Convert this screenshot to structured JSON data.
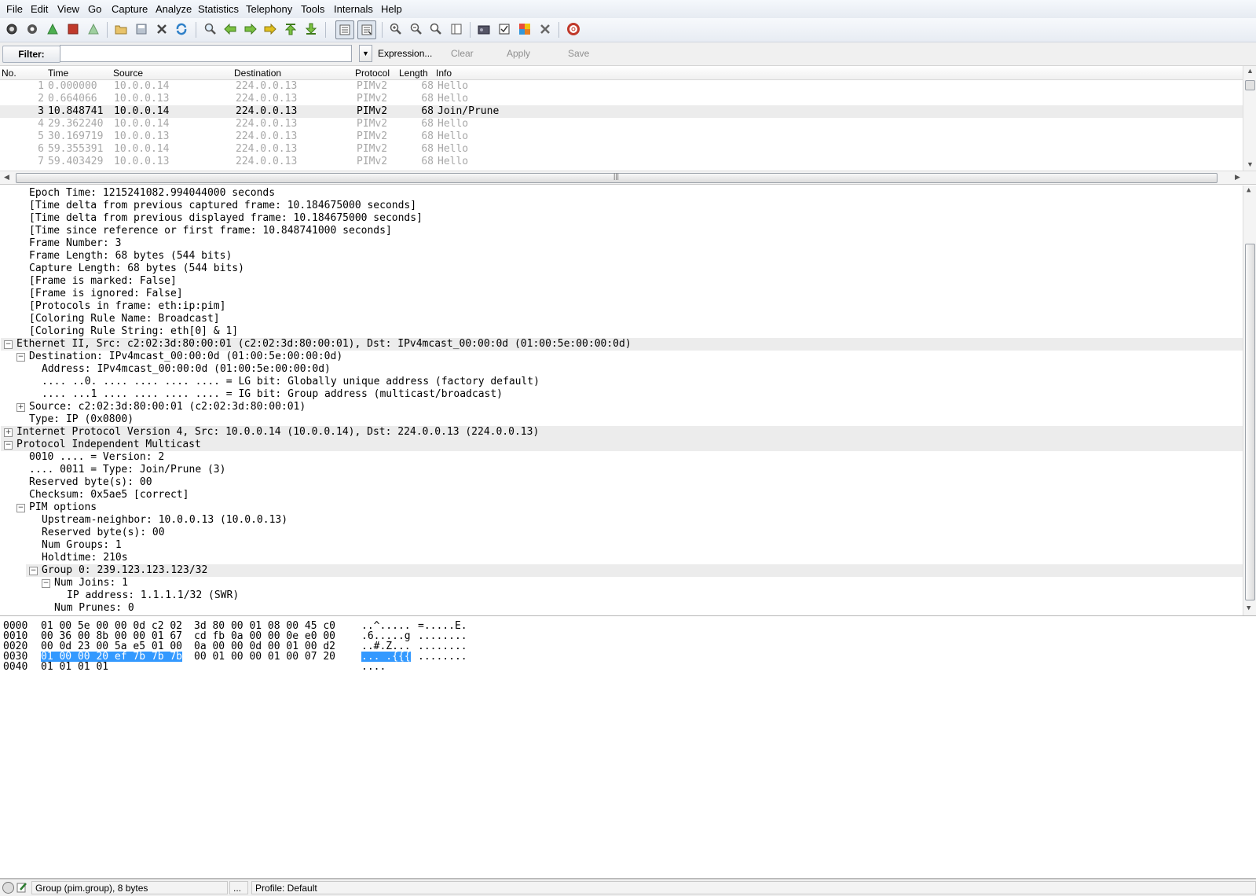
{
  "menu": [
    "File",
    "Edit",
    "View",
    "Go",
    "Capture",
    "Analyze",
    "Statistics",
    "Telephony",
    "Tools",
    "Internals",
    "Help"
  ],
  "filter": {
    "label": "Filter:",
    "value": "",
    "expression": "Expression...",
    "clear": "Clear",
    "apply": "Apply",
    "save": "Save"
  },
  "columns": {
    "no": "No.",
    "time": "Time",
    "source": "Source",
    "destination": "Destination",
    "protocol": "Protocol",
    "length": "Length",
    "info": "Info"
  },
  "packets": [
    {
      "no": "1",
      "time": "0.000000",
      "src": "10.0.0.14",
      "dst": "224.0.0.13",
      "proto": "PIMv2",
      "len": "68",
      "info": "Hello"
    },
    {
      "no": "2",
      "time": "0.664066",
      "src": "10.0.0.13",
      "dst": "224.0.0.13",
      "proto": "PIMv2",
      "len": "68",
      "info": "Hello"
    },
    {
      "no": "3",
      "time": "10.848741",
      "src": "10.0.0.14",
      "dst": "224.0.0.13",
      "proto": "PIMv2",
      "len": "68",
      "info": "Join/Prune"
    },
    {
      "no": "4",
      "time": "29.362240",
      "src": "10.0.0.14",
      "dst": "224.0.0.13",
      "proto": "PIMv2",
      "len": "68",
      "info": "Hello"
    },
    {
      "no": "5",
      "time": "30.169719",
      "src": "10.0.0.13",
      "dst": "224.0.0.13",
      "proto": "PIMv2",
      "len": "68",
      "info": "Hello"
    },
    {
      "no": "6",
      "time": "59.355391",
      "src": "10.0.0.14",
      "dst": "224.0.0.13",
      "proto": "PIMv2",
      "len": "68",
      "info": "Hello"
    },
    {
      "no": "7",
      "time": "59.403429",
      "src": "10.0.0.13",
      "dst": "224.0.0.13",
      "proto": "PIMv2",
      "len": "68",
      "info": "Hello"
    }
  ],
  "details": [
    {
      "t": "Epoch Time: 1215241082.994044000 seconds"
    },
    {
      "t": "[Time delta from previous captured frame: 10.184675000 seconds]"
    },
    {
      "t": "[Time delta from previous displayed frame: 10.184675000 seconds]"
    },
    {
      "t": "[Time since reference or first frame: 10.848741000 seconds]"
    },
    {
      "t": "Frame Number: 3"
    },
    {
      "t": "Frame Length: 68 bytes (544 bits)"
    },
    {
      "t": "Capture Length: 68 bytes (544 bits)"
    },
    {
      "t": "[Frame is marked: False]"
    },
    {
      "t": "[Frame is ignored: False]"
    },
    {
      "t": "[Protocols in frame: eth:ip:pim]"
    },
    {
      "t": "[Coloring Rule Name: Broadcast]"
    },
    {
      "t": "[Coloring Rule String: eth[0] & 1]"
    },
    {
      "t": "Ethernet II, Src: c2:02:3d:80:00:01 (c2:02:3d:80:00:01), Dst: IPv4mcast_00:00:0d (01:00:5e:00:00:0d)"
    },
    {
      "t": "Destination: IPv4mcast_00:00:0d (01:00:5e:00:00:0d)"
    },
    {
      "t": "Address: IPv4mcast_00:00:0d (01:00:5e:00:00:0d)"
    },
    {
      "t": ".... ..0. .... .... .... .... = LG bit: Globally unique address (factory default)"
    },
    {
      "t": ".... ...1 .... .... .... .... = IG bit: Group address (multicast/broadcast)"
    },
    {
      "t": "Source: c2:02:3d:80:00:01 (c2:02:3d:80:00:01)"
    },
    {
      "t": "Type: IP (0x0800)"
    },
    {
      "t": "Internet Protocol Version 4, Src: 10.0.0.14 (10.0.0.14), Dst: 224.0.0.13 (224.0.0.13)"
    },
    {
      "t": "Protocol Independent Multicast"
    },
    {
      "t": "0010 .... = Version: 2"
    },
    {
      "t": ".... 0011 = Type: Join/Prune (3)"
    },
    {
      "t": "Reserved byte(s): 00"
    },
    {
      "t": "Checksum: 0x5ae5 [correct]"
    },
    {
      "t": "PIM options"
    },
    {
      "t": "Upstream-neighbor: 10.0.0.13 (10.0.0.13)"
    },
    {
      "t": "Reserved byte(s): 00"
    },
    {
      "t": "Num Groups: 1"
    },
    {
      "t": "Holdtime: 210s"
    },
    {
      "t": "Group 0: 239.123.123.123/32"
    },
    {
      "t": "Num Joins: 1"
    },
    {
      "t": "IP address: 1.1.1.1/32 (SWR)"
    },
    {
      "t": "Num Prunes: 0"
    }
  ],
  "bytes": [
    {
      "off": "0000",
      "hex1": "01 00 5e 00 00 0d c2 02",
      "hex2": "3d 80 00 01 08 00 45 c0",
      "asc1": "..^.....",
      "asc2": "=.....E."
    },
    {
      "off": "0010",
      "hex1": "00 36 00 8b 00 00 01 67",
      "hex2": "cd fb 0a 00 00 0e e0 00",
      "asc1": ".6.....g",
      "asc2": "........"
    },
    {
      "off": "0020",
      "hex1": "00 0d 23 00 5a e5 01 00",
      "hex2": "0a 00 00 0d 00 01 00 d2",
      "asc1": "..#.Z...",
      "asc2": "........"
    },
    {
      "off": "0030",
      "hex1": "01 00 00 20 ef 7b 7b 7b",
      "hex2": "00 01 00 00 01 00 07 20",
      "asc1": "... .{{{",
      "asc2": "........"
    },
    {
      "off": "0040",
      "hex1": "01 01 01 01",
      "hex2": "",
      "asc1": "....",
      "asc2": ""
    }
  ],
  "status": {
    "field": "Group (pim.group), 8 bytes",
    "ellipsis": "...",
    "profile": "Profile: Default"
  },
  "colors": {
    "selection": "#3399ff",
    "dim_row": "#a8a8a8",
    "row_highlight": "#ececec"
  }
}
